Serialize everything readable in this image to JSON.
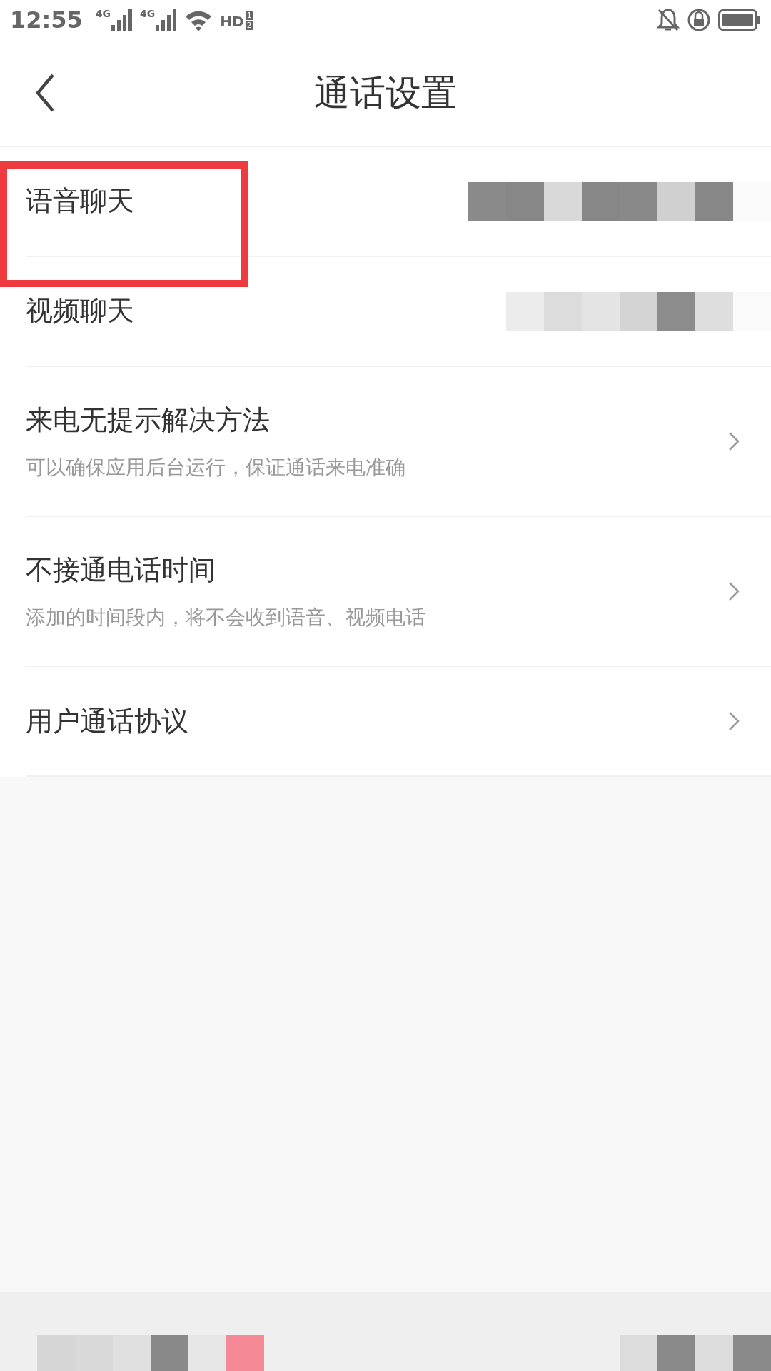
{
  "status_bar": {
    "time": "12:55",
    "networks": [
      {
        "label": "4G"
      },
      {
        "label": "4G"
      }
    ],
    "hd_label": "HD",
    "sim_numbers": [
      "1",
      "2"
    ]
  },
  "header": {
    "title": "通话设置"
  },
  "settings": [
    {
      "title": "语音聊天",
      "kind": "redacted",
      "highlighted": true
    },
    {
      "title": "视频聊天",
      "kind": "redacted",
      "highlighted": false
    },
    {
      "title": "来电无提示解决方法",
      "subtitle": "可以确保应用后台运行，保证通话来电准确",
      "kind": "link",
      "highlighted": false
    },
    {
      "title": "不接通电话时间",
      "subtitle": "添加的时间段内，将不会收到语音、视频电话",
      "kind": "link",
      "highlighted": false
    },
    {
      "title": "用户通话协议",
      "kind": "link",
      "highlighted": false
    }
  ]
}
